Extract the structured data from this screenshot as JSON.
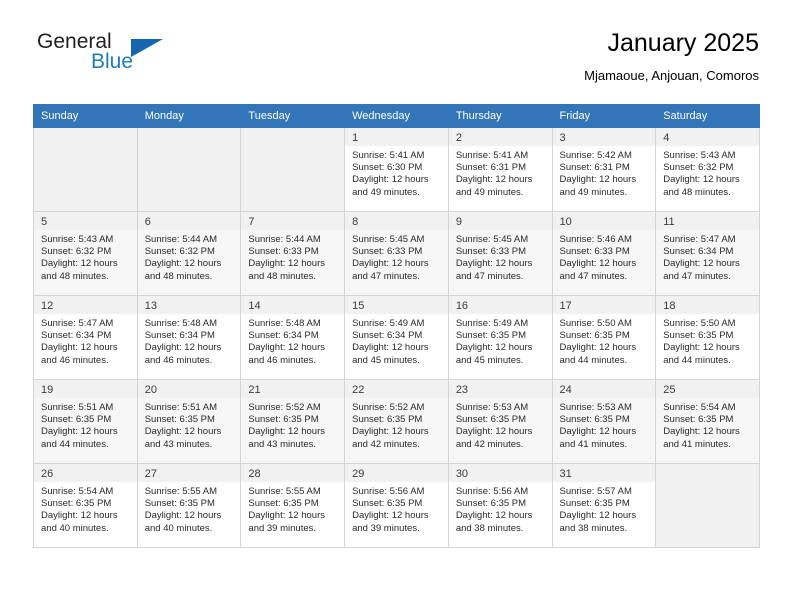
{
  "logo": {
    "word1": "General",
    "word2": "Blue",
    "triangle_color": "#1566ae",
    "blue_color": "#1f7bc1"
  },
  "header": {
    "title": "January 2025",
    "subtitle": "Mjamaoue, Anjouan, Comoros"
  },
  "theme": {
    "header_bg": "#3275b8",
    "header_text": "#ffffff",
    "cell_border": "#d4d4d4",
    "daynum_bg": "#f1f1f1",
    "shaded_row_bg": "#f6f6f6"
  },
  "calendar": {
    "weekday_headers": [
      "Sunday",
      "Monday",
      "Tuesday",
      "Wednesday",
      "Thursday",
      "Friday",
      "Saturday"
    ],
    "labels": {
      "sunrise": "Sunrise:",
      "sunset": "Sunset:",
      "daylight": "Daylight:"
    },
    "weeks": [
      [
        {
          "empty": true
        },
        {
          "empty": true
        },
        {
          "empty": true
        },
        {
          "day": "1",
          "sunrise": "Sunrise: 5:41 AM",
          "sunset": "Sunset: 6:30 PM",
          "daylight": "Daylight: 12 hours and 49 minutes."
        },
        {
          "day": "2",
          "sunrise": "Sunrise: 5:41 AM",
          "sunset": "Sunset: 6:31 PM",
          "daylight": "Daylight: 12 hours and 49 minutes."
        },
        {
          "day": "3",
          "sunrise": "Sunrise: 5:42 AM",
          "sunset": "Sunset: 6:31 PM",
          "daylight": "Daylight: 12 hours and 49 minutes."
        },
        {
          "day": "4",
          "sunrise": "Sunrise: 5:43 AM",
          "sunset": "Sunset: 6:32 PM",
          "daylight": "Daylight: 12 hours and 48 minutes."
        }
      ],
      [
        {
          "day": "5",
          "sunrise": "Sunrise: 5:43 AM",
          "sunset": "Sunset: 6:32 PM",
          "daylight": "Daylight: 12 hours and 48 minutes."
        },
        {
          "day": "6",
          "sunrise": "Sunrise: 5:44 AM",
          "sunset": "Sunset: 6:32 PM",
          "daylight": "Daylight: 12 hours and 48 minutes."
        },
        {
          "day": "7",
          "sunrise": "Sunrise: 5:44 AM",
          "sunset": "Sunset: 6:33 PM",
          "daylight": "Daylight: 12 hours and 48 minutes."
        },
        {
          "day": "8",
          "sunrise": "Sunrise: 5:45 AM",
          "sunset": "Sunset: 6:33 PM",
          "daylight": "Daylight: 12 hours and 47 minutes."
        },
        {
          "day": "9",
          "sunrise": "Sunrise: 5:45 AM",
          "sunset": "Sunset: 6:33 PM",
          "daylight": "Daylight: 12 hours and 47 minutes."
        },
        {
          "day": "10",
          "sunrise": "Sunrise: 5:46 AM",
          "sunset": "Sunset: 6:33 PM",
          "daylight": "Daylight: 12 hours and 47 minutes."
        },
        {
          "day": "11",
          "sunrise": "Sunrise: 5:47 AM",
          "sunset": "Sunset: 6:34 PM",
          "daylight": "Daylight: 12 hours and 47 minutes."
        }
      ],
      [
        {
          "day": "12",
          "sunrise": "Sunrise: 5:47 AM",
          "sunset": "Sunset: 6:34 PM",
          "daylight": "Daylight: 12 hours and 46 minutes."
        },
        {
          "day": "13",
          "sunrise": "Sunrise: 5:48 AM",
          "sunset": "Sunset: 6:34 PM",
          "daylight": "Daylight: 12 hours and 46 minutes."
        },
        {
          "day": "14",
          "sunrise": "Sunrise: 5:48 AM",
          "sunset": "Sunset: 6:34 PM",
          "daylight": "Daylight: 12 hours and 46 minutes."
        },
        {
          "day": "15",
          "sunrise": "Sunrise: 5:49 AM",
          "sunset": "Sunset: 6:34 PM",
          "daylight": "Daylight: 12 hours and 45 minutes."
        },
        {
          "day": "16",
          "sunrise": "Sunrise: 5:49 AM",
          "sunset": "Sunset: 6:35 PM",
          "daylight": "Daylight: 12 hours and 45 minutes."
        },
        {
          "day": "17",
          "sunrise": "Sunrise: 5:50 AM",
          "sunset": "Sunset: 6:35 PM",
          "daylight": "Daylight: 12 hours and 44 minutes."
        },
        {
          "day": "18",
          "sunrise": "Sunrise: 5:50 AM",
          "sunset": "Sunset: 6:35 PM",
          "daylight": "Daylight: 12 hours and 44 minutes."
        }
      ],
      [
        {
          "day": "19",
          "sunrise": "Sunrise: 5:51 AM",
          "sunset": "Sunset: 6:35 PM",
          "daylight": "Daylight: 12 hours and 44 minutes."
        },
        {
          "day": "20",
          "sunrise": "Sunrise: 5:51 AM",
          "sunset": "Sunset: 6:35 PM",
          "daylight": "Daylight: 12 hours and 43 minutes."
        },
        {
          "day": "21",
          "sunrise": "Sunrise: 5:52 AM",
          "sunset": "Sunset: 6:35 PM",
          "daylight": "Daylight: 12 hours and 43 minutes."
        },
        {
          "day": "22",
          "sunrise": "Sunrise: 5:52 AM",
          "sunset": "Sunset: 6:35 PM",
          "daylight": "Daylight: 12 hours and 42 minutes."
        },
        {
          "day": "23",
          "sunrise": "Sunrise: 5:53 AM",
          "sunset": "Sunset: 6:35 PM",
          "daylight": "Daylight: 12 hours and 42 minutes."
        },
        {
          "day": "24",
          "sunrise": "Sunrise: 5:53 AM",
          "sunset": "Sunset: 6:35 PM",
          "daylight": "Daylight: 12 hours and 41 minutes."
        },
        {
          "day": "25",
          "sunrise": "Sunrise: 5:54 AM",
          "sunset": "Sunset: 6:35 PM",
          "daylight": "Daylight: 12 hours and 41 minutes."
        }
      ],
      [
        {
          "day": "26",
          "sunrise": "Sunrise: 5:54 AM",
          "sunset": "Sunset: 6:35 PM",
          "daylight": "Daylight: 12 hours and 40 minutes."
        },
        {
          "day": "27",
          "sunrise": "Sunrise: 5:55 AM",
          "sunset": "Sunset: 6:35 PM",
          "daylight": "Daylight: 12 hours and 40 minutes."
        },
        {
          "day": "28",
          "sunrise": "Sunrise: 5:55 AM",
          "sunset": "Sunset: 6:35 PM",
          "daylight": "Daylight: 12 hours and 39 minutes."
        },
        {
          "day": "29",
          "sunrise": "Sunrise: 5:56 AM",
          "sunset": "Sunset: 6:35 PM",
          "daylight": "Daylight: 12 hours and 39 minutes."
        },
        {
          "day": "30",
          "sunrise": "Sunrise: 5:56 AM",
          "sunset": "Sunset: 6:35 PM",
          "daylight": "Daylight: 12 hours and 38 minutes."
        },
        {
          "day": "31",
          "sunrise": "Sunrise: 5:57 AM",
          "sunset": "Sunset: 6:35 PM",
          "daylight": "Daylight: 12 hours and 38 minutes."
        },
        {
          "empty": true
        }
      ]
    ]
  }
}
